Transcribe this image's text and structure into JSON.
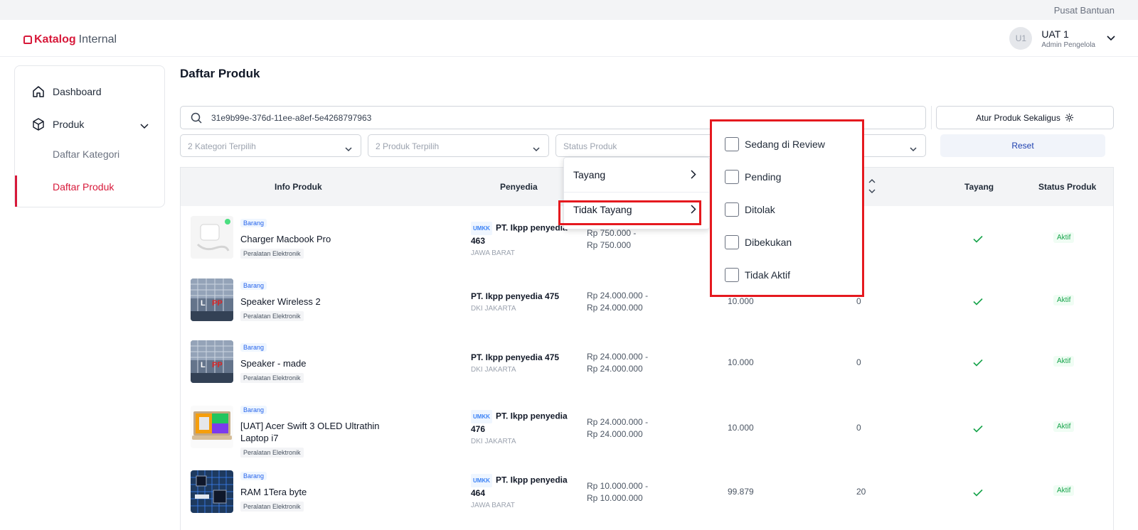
{
  "topbar": {
    "help_link": "Pusat Bantuan"
  },
  "header": {
    "logo_brand": "Katalog",
    "logo_sub": "Internal",
    "user": {
      "initials": "U1",
      "name": "UAT 1",
      "role": "Admin Pengelola"
    }
  },
  "sidebar": {
    "dashboard": "Dashboard",
    "produk": "Produk",
    "daftar_kategori": "Daftar Kategori",
    "daftar_produk": "Daftar Produk"
  },
  "page": {
    "title": "Daftar Produk"
  },
  "search": {
    "value": "31e9b99e-376d-11ee-a8ef-5e4268797963"
  },
  "bulk_button": "Atur Produk Sekaligus",
  "filters": {
    "kategori": "2 Kategori Terpilih",
    "produk": "2 Produk Terpilih",
    "status": "Status Produk",
    "reset": "Reset"
  },
  "table": {
    "headers": {
      "info": "Info Produk",
      "penyedia": "Penyedia",
      "tayang": "Tayang",
      "status": "Status Produk"
    },
    "rows": [
      {
        "tag": "Barang",
        "name": "Charger Macbook Pro",
        "category": "Peralatan Elektronik",
        "umkk": "UMKK",
        "vendor": "PT. Ikpp penyedia 463",
        "location": "JAWA BARAT",
        "price_min": "Rp 750.000 -",
        "price_max": "Rp 750.000",
        "stock": "",
        "sold": "",
        "status": "Aktif"
      },
      {
        "tag": "Barang",
        "name": "Speaker Wireless 2",
        "category": "Peralatan Elektronik",
        "umkk": "",
        "vendor": "PT. Ikpp penyedia 475",
        "location": "DKI JAKARTA",
        "price_min": "Rp 24.000.000 -",
        "price_max": "Rp 24.000.000",
        "stock": "10.000",
        "sold": "0",
        "status": "Aktif"
      },
      {
        "tag": "Barang",
        "name": "Speaker - made",
        "category": "Peralatan Elektronik",
        "umkk": "",
        "vendor": "PT. Ikpp penyedia 475",
        "location": "DKI JAKARTA",
        "price_min": "Rp 24.000.000 -",
        "price_max": "Rp 24.000.000",
        "stock": "10.000",
        "sold": "0",
        "status": "Aktif"
      },
      {
        "tag": "Barang",
        "name": "[UAT] Acer Swift 3 OLED Ultrathin Laptop i7",
        "category": "Peralatan Elektronik",
        "umkk": "UMKK",
        "vendor": "PT. Ikpp penyedia 476",
        "location": "DKI JAKARTA",
        "price_min": "Rp 24.000.000 -",
        "price_max": "Rp 24.000.000",
        "stock": "10.000",
        "sold": "0",
        "status": "Aktif"
      },
      {
        "tag": "Barang",
        "name": "RAM 1Tera byte",
        "category": "Peralatan Elektronik",
        "umkk": "UMKK",
        "vendor": "PT. Ikpp penyedia 464",
        "location": "JAWA BARAT",
        "price_min": "Rp 10.000.000 -",
        "price_max": "Rp 10.000.000",
        "stock": "99.879",
        "sold": "20",
        "status": "Aktif"
      }
    ]
  },
  "status_menu": {
    "tayang": "Tayang",
    "tidak_tayang": "Tidak Tayang",
    "sub_options": [
      "Sedang di Review",
      "Pending",
      "Ditolak",
      "Dibekukan",
      "Tidak Aktif"
    ]
  },
  "colors": {
    "brand": "#d7193a",
    "highlight": "#e5191f",
    "success": "#16a34a",
    "link": "#1e40af"
  }
}
